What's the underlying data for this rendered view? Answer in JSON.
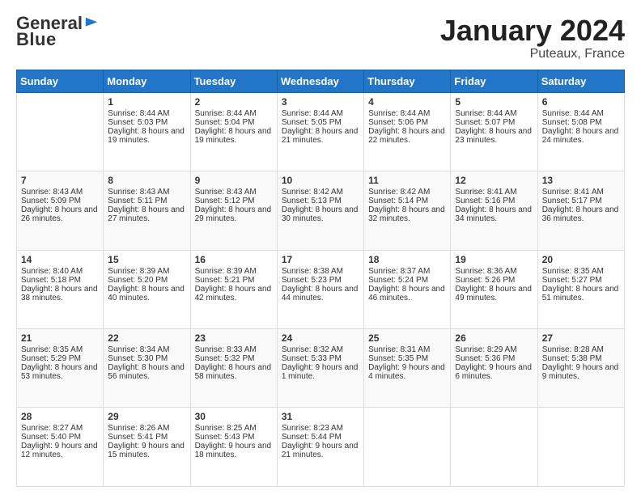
{
  "header": {
    "logo_general": "General",
    "logo_blue": "Blue",
    "title": "January 2024",
    "location": "Puteaux, France"
  },
  "days_of_week": [
    "Sunday",
    "Monday",
    "Tuesday",
    "Wednesday",
    "Thursday",
    "Friday",
    "Saturday"
  ],
  "weeks": [
    [
      {
        "day": "",
        "sunrise": "",
        "sunset": "",
        "daylight": ""
      },
      {
        "day": "1",
        "sunrise": "Sunrise: 8:44 AM",
        "sunset": "Sunset: 5:03 PM",
        "daylight": "Daylight: 8 hours and 19 minutes."
      },
      {
        "day": "2",
        "sunrise": "Sunrise: 8:44 AM",
        "sunset": "Sunset: 5:04 PM",
        "daylight": "Daylight: 8 hours and 19 minutes."
      },
      {
        "day": "3",
        "sunrise": "Sunrise: 8:44 AM",
        "sunset": "Sunset: 5:05 PM",
        "daylight": "Daylight: 8 hours and 21 minutes."
      },
      {
        "day": "4",
        "sunrise": "Sunrise: 8:44 AM",
        "sunset": "Sunset: 5:06 PM",
        "daylight": "Daylight: 8 hours and 22 minutes."
      },
      {
        "day": "5",
        "sunrise": "Sunrise: 8:44 AM",
        "sunset": "Sunset: 5:07 PM",
        "daylight": "Daylight: 8 hours and 23 minutes."
      },
      {
        "day": "6",
        "sunrise": "Sunrise: 8:44 AM",
        "sunset": "Sunset: 5:08 PM",
        "daylight": "Daylight: 8 hours and 24 minutes."
      }
    ],
    [
      {
        "day": "7",
        "sunrise": "Sunrise: 8:43 AM",
        "sunset": "Sunset: 5:09 PM",
        "daylight": "Daylight: 8 hours and 26 minutes."
      },
      {
        "day": "8",
        "sunrise": "Sunrise: 8:43 AM",
        "sunset": "Sunset: 5:11 PM",
        "daylight": "Daylight: 8 hours and 27 minutes."
      },
      {
        "day": "9",
        "sunrise": "Sunrise: 8:43 AM",
        "sunset": "Sunset: 5:12 PM",
        "daylight": "Daylight: 8 hours and 29 minutes."
      },
      {
        "day": "10",
        "sunrise": "Sunrise: 8:42 AM",
        "sunset": "Sunset: 5:13 PM",
        "daylight": "Daylight: 8 hours and 30 minutes."
      },
      {
        "day": "11",
        "sunrise": "Sunrise: 8:42 AM",
        "sunset": "Sunset: 5:14 PM",
        "daylight": "Daylight: 8 hours and 32 minutes."
      },
      {
        "day": "12",
        "sunrise": "Sunrise: 8:41 AM",
        "sunset": "Sunset: 5:16 PM",
        "daylight": "Daylight: 8 hours and 34 minutes."
      },
      {
        "day": "13",
        "sunrise": "Sunrise: 8:41 AM",
        "sunset": "Sunset: 5:17 PM",
        "daylight": "Daylight: 8 hours and 36 minutes."
      }
    ],
    [
      {
        "day": "14",
        "sunrise": "Sunrise: 8:40 AM",
        "sunset": "Sunset: 5:18 PM",
        "daylight": "Daylight: 8 hours and 38 minutes."
      },
      {
        "day": "15",
        "sunrise": "Sunrise: 8:39 AM",
        "sunset": "Sunset: 5:20 PM",
        "daylight": "Daylight: 8 hours and 40 minutes."
      },
      {
        "day": "16",
        "sunrise": "Sunrise: 8:39 AM",
        "sunset": "Sunset: 5:21 PM",
        "daylight": "Daylight: 8 hours and 42 minutes."
      },
      {
        "day": "17",
        "sunrise": "Sunrise: 8:38 AM",
        "sunset": "Sunset: 5:23 PM",
        "daylight": "Daylight: 8 hours and 44 minutes."
      },
      {
        "day": "18",
        "sunrise": "Sunrise: 8:37 AM",
        "sunset": "Sunset: 5:24 PM",
        "daylight": "Daylight: 8 hours and 46 minutes."
      },
      {
        "day": "19",
        "sunrise": "Sunrise: 8:36 AM",
        "sunset": "Sunset: 5:26 PM",
        "daylight": "Daylight: 8 hours and 49 minutes."
      },
      {
        "day": "20",
        "sunrise": "Sunrise: 8:35 AM",
        "sunset": "Sunset: 5:27 PM",
        "daylight": "Daylight: 8 hours and 51 minutes."
      }
    ],
    [
      {
        "day": "21",
        "sunrise": "Sunrise: 8:35 AM",
        "sunset": "Sunset: 5:29 PM",
        "daylight": "Daylight: 8 hours and 53 minutes."
      },
      {
        "day": "22",
        "sunrise": "Sunrise: 8:34 AM",
        "sunset": "Sunset: 5:30 PM",
        "daylight": "Daylight: 8 hours and 56 minutes."
      },
      {
        "day": "23",
        "sunrise": "Sunrise: 8:33 AM",
        "sunset": "Sunset: 5:32 PM",
        "daylight": "Daylight: 8 hours and 58 minutes."
      },
      {
        "day": "24",
        "sunrise": "Sunrise: 8:32 AM",
        "sunset": "Sunset: 5:33 PM",
        "daylight": "Daylight: 9 hours and 1 minute."
      },
      {
        "day": "25",
        "sunrise": "Sunrise: 8:31 AM",
        "sunset": "Sunset: 5:35 PM",
        "daylight": "Daylight: 9 hours and 4 minutes."
      },
      {
        "day": "26",
        "sunrise": "Sunrise: 8:29 AM",
        "sunset": "Sunset: 5:36 PM",
        "daylight": "Daylight: 9 hours and 6 minutes."
      },
      {
        "day": "27",
        "sunrise": "Sunrise: 8:28 AM",
        "sunset": "Sunset: 5:38 PM",
        "daylight": "Daylight: 9 hours and 9 minutes."
      }
    ],
    [
      {
        "day": "28",
        "sunrise": "Sunrise: 8:27 AM",
        "sunset": "Sunset: 5:40 PM",
        "daylight": "Daylight: 9 hours and 12 minutes."
      },
      {
        "day": "29",
        "sunrise": "Sunrise: 8:26 AM",
        "sunset": "Sunset: 5:41 PM",
        "daylight": "Daylight: 9 hours and 15 minutes."
      },
      {
        "day": "30",
        "sunrise": "Sunrise: 8:25 AM",
        "sunset": "Sunset: 5:43 PM",
        "daylight": "Daylight: 9 hours and 18 minutes."
      },
      {
        "day": "31",
        "sunrise": "Sunrise: 8:23 AM",
        "sunset": "Sunset: 5:44 PM",
        "daylight": "Daylight: 9 hours and 21 minutes."
      },
      {
        "day": "",
        "sunrise": "",
        "sunset": "",
        "daylight": ""
      },
      {
        "day": "",
        "sunrise": "",
        "sunset": "",
        "daylight": ""
      },
      {
        "day": "",
        "sunrise": "",
        "sunset": "",
        "daylight": ""
      }
    ]
  ]
}
